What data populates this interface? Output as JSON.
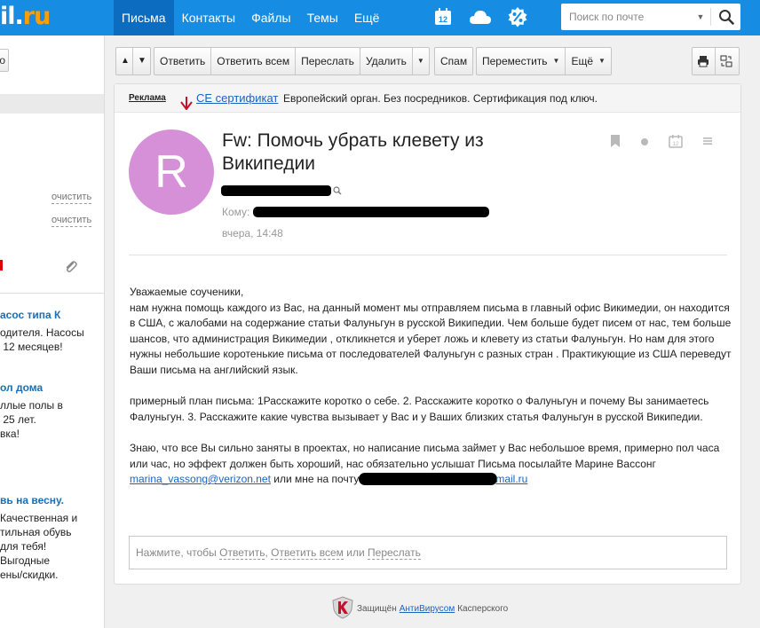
{
  "logo": {
    "text": "il.",
    "tld": "ru"
  },
  "nav": [
    {
      "label": "Письма",
      "active": true
    },
    {
      "label": "Контакты",
      "active": false
    },
    {
      "label": "Файлы",
      "active": false
    },
    {
      "label": "Темы",
      "active": false
    },
    {
      "label": "Ещё",
      "active": false
    }
  ],
  "top_icons": [
    "calendar-icon",
    "cloud-icon",
    "percent-icon"
  ],
  "calendar_day": "12",
  "search": {
    "placeholder": "Поиск по почте"
  },
  "sidebar": {
    "clear_1": "очистить",
    "clear_2": "очистить",
    "left_button": "о",
    "ads": [
      {
        "title": "асос типа К",
        "text": "одителя. Насосы\n 12 месяцев!"
      },
      {
        "title": "ол дома",
        "text": "ллые полы в\n 25 лет.\nвка!"
      },
      {
        "title": "вь на весну.",
        "text": "Качественная и\nтильная обувь\nдля тебя!\nВыгодные\nены/скидки."
      }
    ]
  },
  "toolbar": {
    "reply": "Ответить",
    "reply_all": "Ответить всем",
    "forward": "Переслать",
    "delete": "Удалить",
    "spam": "Спам",
    "move": "Переместить",
    "more": "Ещё"
  },
  "ad_line": {
    "label": "Реклама",
    "link": "CE сертификат",
    "text": "Европейский орган. Без посредников. Сертификация под ключ."
  },
  "message": {
    "avatar_letter": "R",
    "subject": "Fw: Помочь убрать клевету из Википедии",
    "to_label": "Кому:",
    "date": "вчера, 14:48",
    "body_1": "Уважаемые соученики,",
    "body_2": "нам нужна помощь каждого из Вас, на данный момент мы отправляем письма в главный офис Викимедии, он находится в США, с жалобами на содержание статьи Фалуньгун в русской Википедии. Чем больше будет писем от нас, тем больше шансов, что администрация Викимедии , откликнется и уберет ложь и клевету из статьи Фалуньгун. Но нам для этого нужны небольшие коротенькие письма от последователей Фалуньгун с разных стран . Практикующие из США переведут Ваши письма на английский язык.",
    "body_3": "примерный план письма: 1Расскажите коротко о себе. 2. Расскажите коротко о Фалуньгун и почему Вы занимаетесь Фалуньгун. 3. Расскажите какие чувства вызывает у Вас и у Ваших близких статья Фалуньгун в русской Википедии.",
    "body_4": "Знаю, что все Вы сильно заняты в проектах, но написание письма займет у Вас небольшое время, примерно пол часа или час, но эффект должен быть хороший, нас обязательно услышат Письма посылайте Марине Вассонг",
    "email_link": "marina_vassong@verizon.net",
    "body_5": "или мне на почту",
    "email_tail": "mail.ru"
  },
  "reply_box": {
    "prefix": "Нажмите, чтобы",
    "reply": "Ответить",
    "reply_all": "Ответить всем",
    "or": "или",
    "forward": "Переслать"
  },
  "footer": {
    "prefix": "Защищён",
    "link": "АнтиВирусом",
    "suffix": "Касперского"
  },
  "colors": {
    "topbar": "#168de2",
    "nav_active": "#0c6cc0",
    "link": "#1a64c0",
    "avatar": "#d690d8"
  }
}
